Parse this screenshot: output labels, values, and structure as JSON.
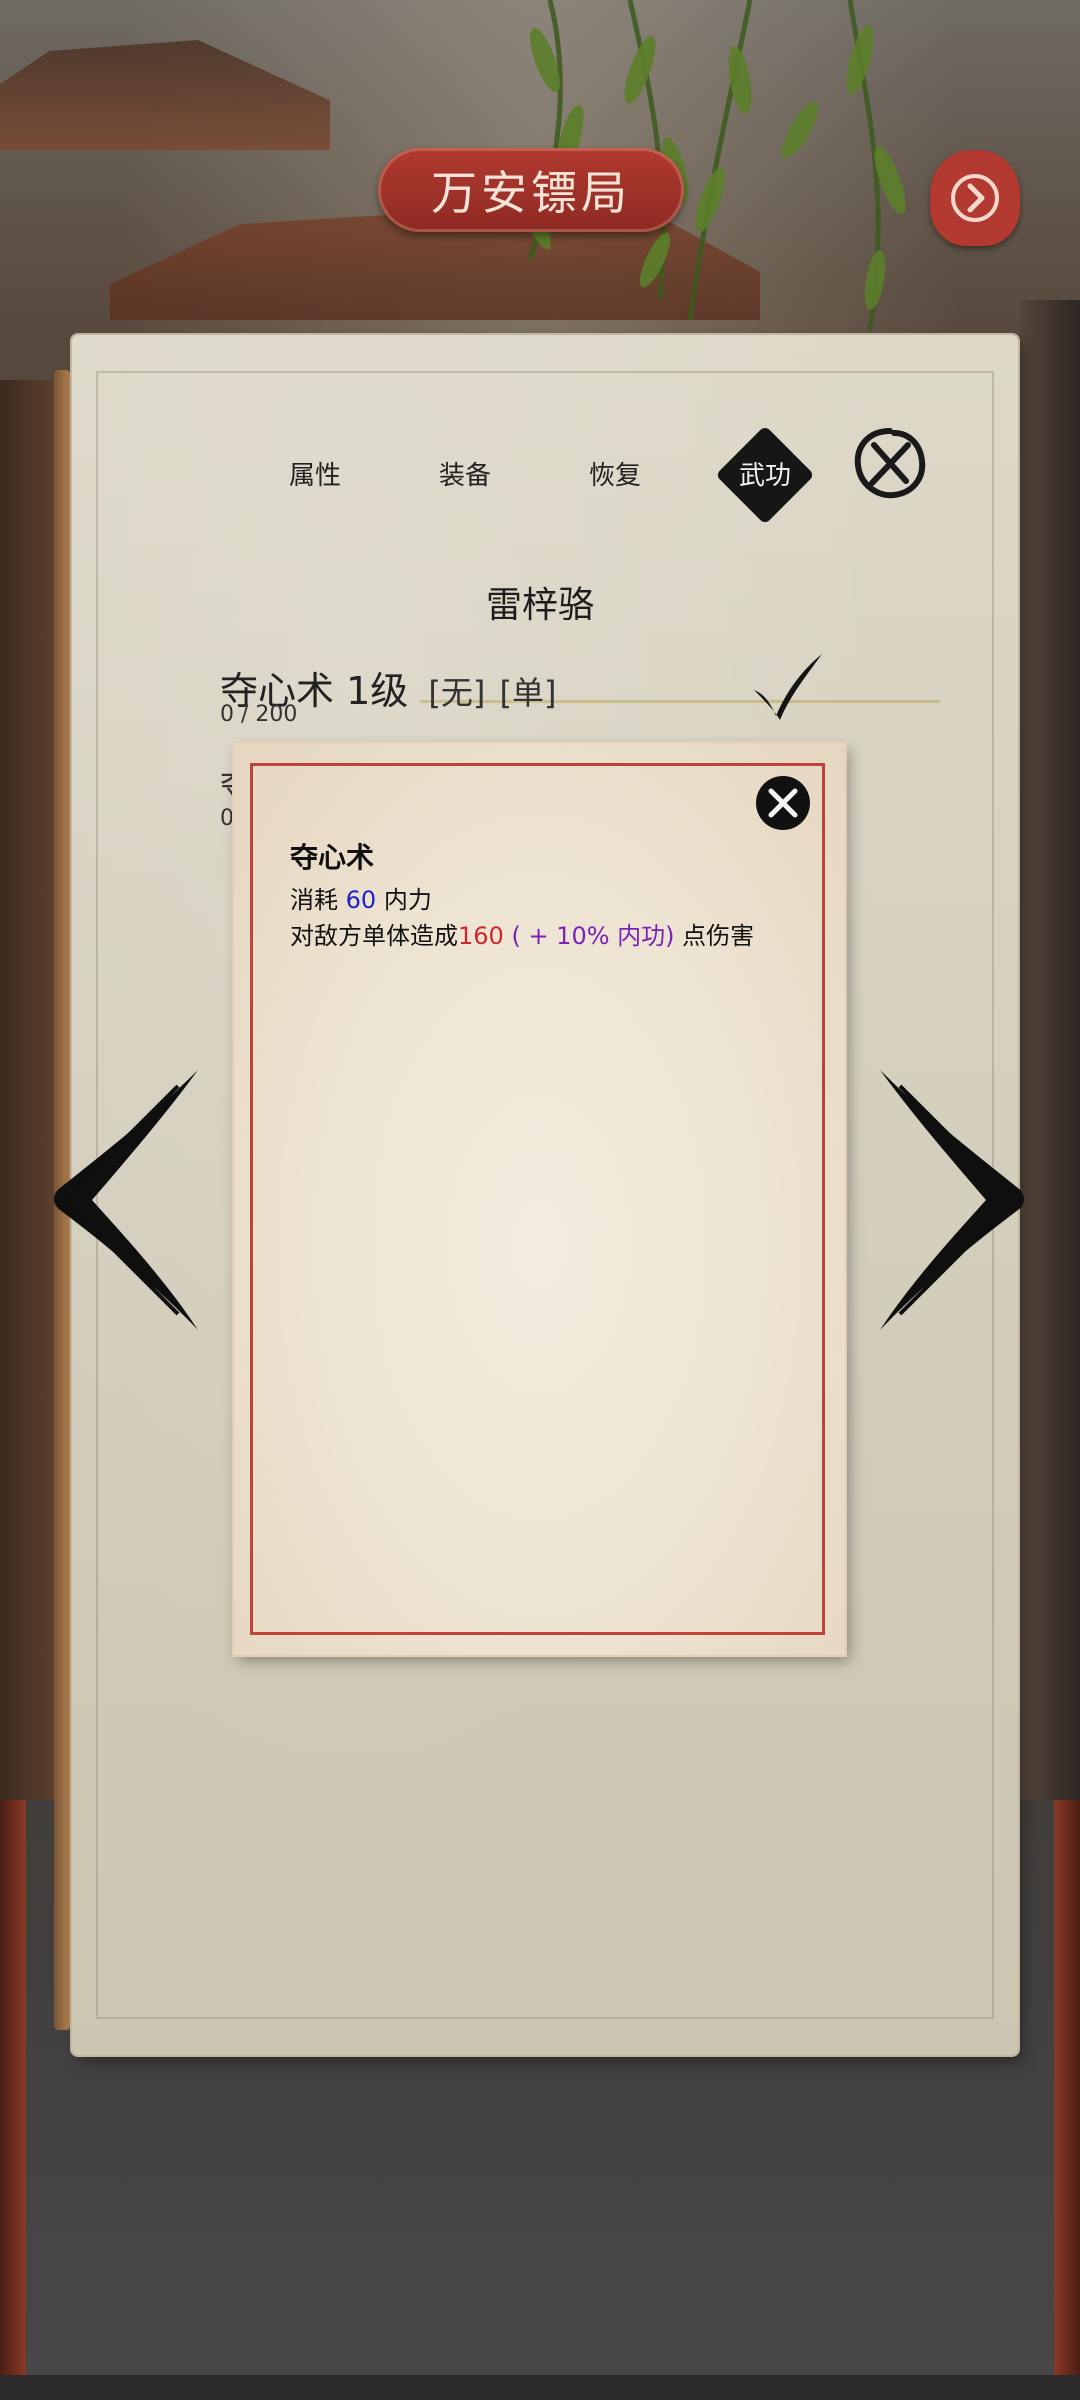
{
  "header": {
    "title": "万安镖局"
  },
  "tabs": [
    {
      "label": "属性",
      "active": false
    },
    {
      "label": "装备",
      "active": false
    },
    {
      "label": "恢复",
      "active": false
    },
    {
      "label": "武功",
      "active": true
    }
  ],
  "character": {
    "name": "雷梓骆"
  },
  "skills": [
    {
      "name": "夺心术",
      "level": "1级",
      "tag_element": "[无]",
      "tag_target": "[单]",
      "progress_text": "0 / 200",
      "progress": 0,
      "selected": true
    },
    {
      "name_stub": "夺",
      "progress_stub": "0"
    }
  ],
  "popup": {
    "title": "夺心术",
    "cost_prefix": "消耗",
    "cost_value": "60",
    "cost_suffix": "内力",
    "effect_prefix": "对敌方单体造成",
    "effect_value": "160",
    "effect_bonus": "( + 10% 内功)",
    "effect_suffix": "点伤害"
  },
  "icons": {
    "next": "arrow-right-icon",
    "close": "close-icon",
    "check": "checkmark-icon",
    "prev_page": "brush-arrow-left-icon",
    "next_page": "brush-arrow-right-icon"
  },
  "colors": {
    "banner": "#b23a30",
    "popup_border": "#c0433a",
    "value_blue": "#2222cc",
    "value_red": "#d0282a",
    "value_purple": "#7a22b8"
  }
}
